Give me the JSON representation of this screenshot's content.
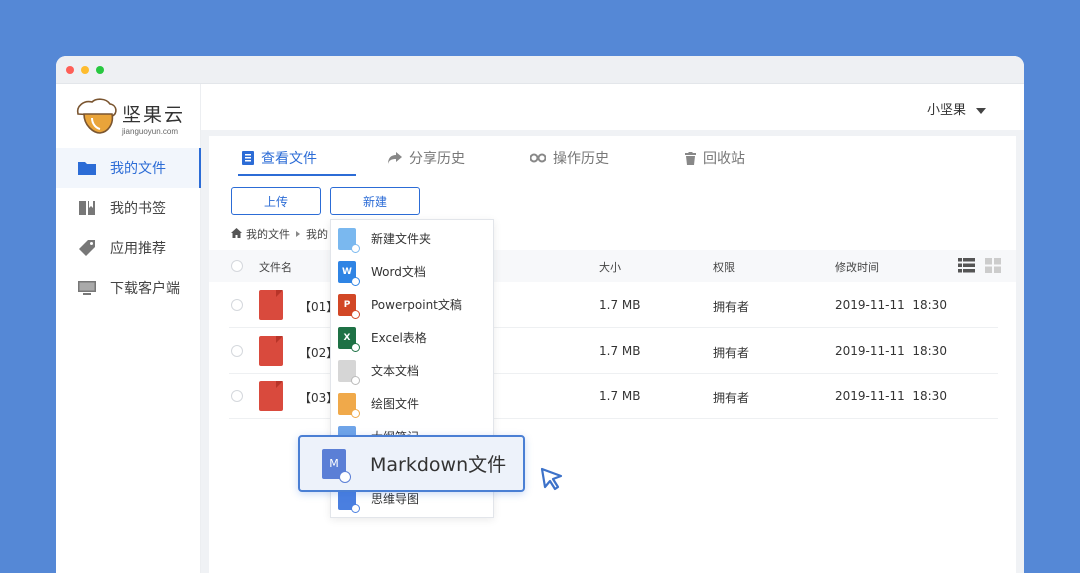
{
  "app": {
    "logo_name": "坚果云",
    "logo_sub": "jianguoyun.com",
    "user": "小坚果"
  },
  "sidebar": {
    "items": [
      {
        "label": "我的文件",
        "icon": "folder-icon"
      },
      {
        "label": "我的书签",
        "icon": "bookmark-icon"
      },
      {
        "label": "应用推荐",
        "icon": "tag-icon"
      },
      {
        "label": "下载客户端",
        "icon": "monitor-icon"
      }
    ]
  },
  "tabs": [
    {
      "label": "查看文件",
      "icon": "file-icon"
    },
    {
      "label": "分享历史",
      "icon": "share-icon"
    },
    {
      "label": "操作历史",
      "icon": "history-icon"
    },
    {
      "label": "回收站",
      "icon": "trash-icon"
    }
  ],
  "toolbar": {
    "upload": "上传",
    "new": "新建"
  },
  "breadcrumb": {
    "root": "我的文件",
    "current": "我的"
  },
  "table": {
    "columns": [
      "文件名",
      "大小",
      "权限",
      "修改时间"
    ],
    "rows": [
      {
        "name": "【01】",
        "size": "1.7 MB",
        "perm": "拥有者",
        "time": "2019-11-11  18:30"
      },
      {
        "name": "【02】",
        "size": "1.7 MB",
        "perm": "拥有者",
        "time": "2019-11-11  18:30"
      },
      {
        "name": "【03】",
        "size": "1.7 MB",
        "perm": "拥有者",
        "time": "2019-11-11  18:30"
      }
    ]
  },
  "new_menu": {
    "items": [
      {
        "label": "新建文件夹",
        "icon": "new-folder-icon",
        "color": "#7ab8ef"
      },
      {
        "label": "Word文档",
        "icon": "word-icon",
        "color": "#2f84e4"
      },
      {
        "label": "Powerpoint文稿",
        "icon": "powerpoint-icon",
        "color": "#d24726"
      },
      {
        "label": "Excel表格",
        "icon": "excel-icon",
        "color": "#1e7145"
      },
      {
        "label": "文本文档",
        "icon": "text-doc-icon",
        "color": "#c8c8c8"
      },
      {
        "label": "绘图文件",
        "icon": "drawing-icon",
        "color": "#f0a94a"
      },
      {
        "label": "大纲笔记",
        "icon": "outline-icon",
        "color": "#6fa4e8"
      },
      {
        "label": "思维导图",
        "icon": "mindmap-icon",
        "color": "#4a7fe0"
      }
    ],
    "highlight": {
      "label": "Markdown文件",
      "icon_letter": "M"
    }
  },
  "colors": {
    "accent": "#2c6cd6",
    "background": "#5588d6"
  }
}
